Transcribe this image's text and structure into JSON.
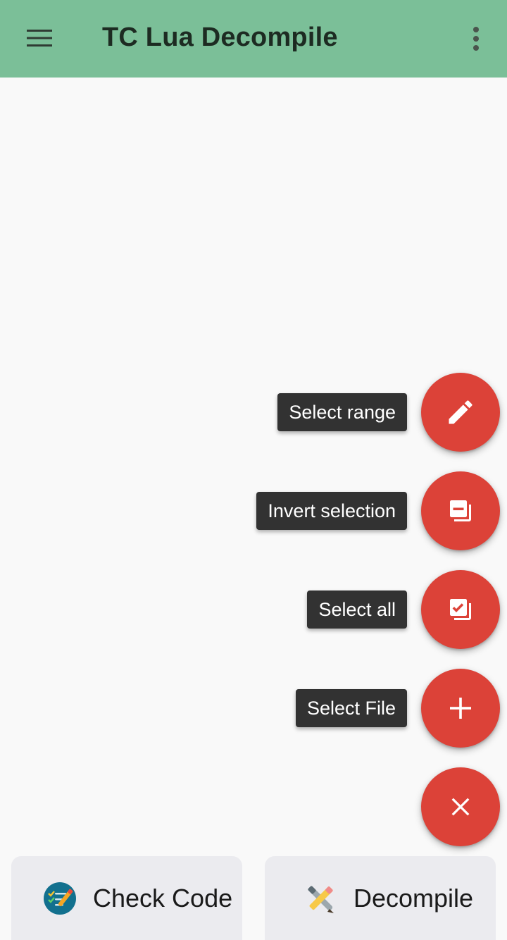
{
  "app": {
    "title": "TC Lua Decompile"
  },
  "colors": {
    "appbar": "#7bbf98",
    "fab": "#dc4238",
    "label_bg": "#323232",
    "bottom_button_bg": "#ebebef"
  },
  "icons": {
    "menu": "hamburger-menu-icon",
    "overflow": "more-vert-icon"
  },
  "fab_actions": [
    {
      "label": "Select range",
      "icon": "pencil-icon"
    },
    {
      "label": "Invert selection",
      "icon": "invert-selection-icon"
    },
    {
      "label": "Select all",
      "icon": "select-all-icon"
    },
    {
      "label": "Select File",
      "icon": "plus-icon"
    }
  ],
  "main_fab": {
    "icon": "close-icon"
  },
  "bottom_bar": {
    "check_code_label": "Check Code",
    "check_code_icon": "checklist-icon",
    "decompile_label": "Decompile",
    "decompile_icon": "tools-icon"
  }
}
